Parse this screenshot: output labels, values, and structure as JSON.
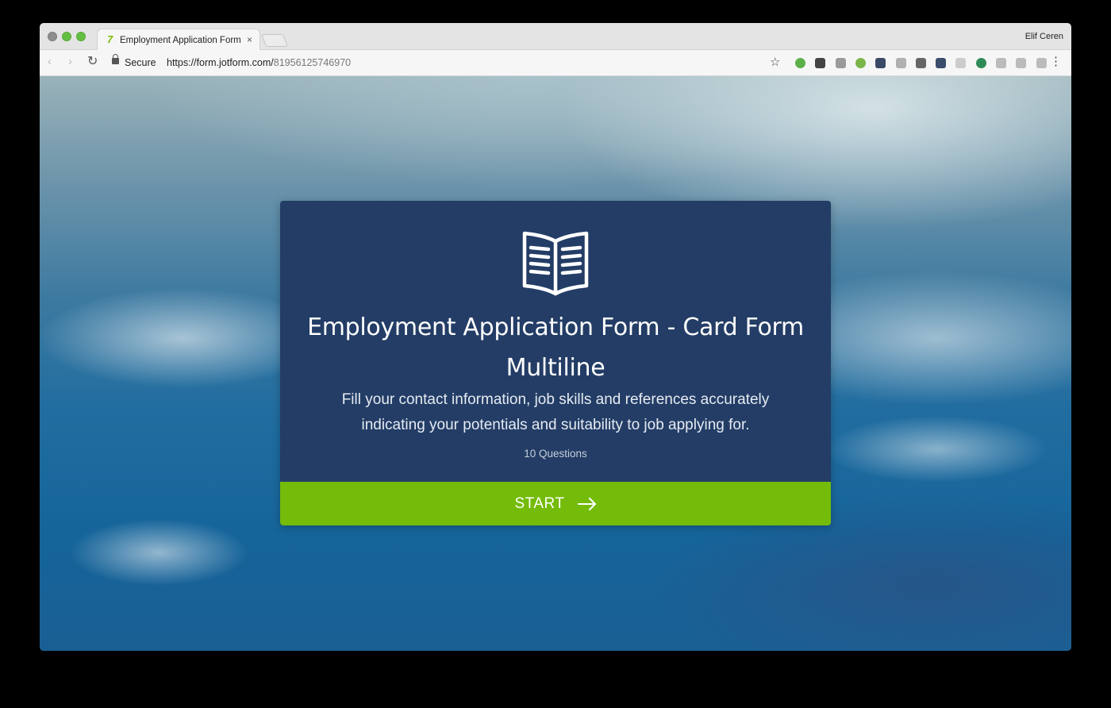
{
  "browser": {
    "tab": {
      "title": "Employment Application Form - Card Form Multiline",
      "close_glyph": "×",
      "favicon_glyph": "7"
    },
    "profile_name": "Elif Ceren",
    "toolbar": {
      "back_glyph": "‹",
      "forward_glyph": "›",
      "reload_glyph": "↻",
      "secure_label": "Secure",
      "url_host": "https://form.jotform.com/",
      "url_path": "81956125746970",
      "star_glyph": "☆",
      "menu_glyph": "⋮"
    },
    "extensions": [
      {
        "name": "ext-green-globe-icon",
        "color": "#5bb04a"
      },
      {
        "name": "ext-panda-icon",
        "color": "#444444"
      },
      {
        "name": "ext-screen-icon",
        "color": "#9a9a9a"
      },
      {
        "name": "ext-green-leaf-icon",
        "color": "#7ab648"
      },
      {
        "name": "ext-mail-icon",
        "color": "#3a4a66"
      },
      {
        "name": "ext-bracket-icon",
        "color": "#b0b0b0"
      },
      {
        "name": "ext-grid-icon",
        "color": "#666666"
      },
      {
        "name": "ext-pocket-icon",
        "color": "#3b4d6b"
      },
      {
        "name": "ext-cursor-icon",
        "color": "#cccccc"
      },
      {
        "name": "ext-green-circle-icon",
        "color": "#2e8b57"
      },
      {
        "name": "ext-columns-icon",
        "color": "#bbbbbb"
      },
      {
        "name": "ext-layout-icon",
        "color": "#bbbbbb"
      },
      {
        "name": "ext-crop-icon",
        "color": "#bbbbbb"
      }
    ]
  },
  "form": {
    "title_line1": "Employment Application Form - Card Form",
    "title_line2": "Multiline",
    "description_line1": "Fill your contact information, job skills and references accurately",
    "description_line2": "indicating your potentials and suitability to job applying for.",
    "question_count": "10 Questions",
    "start_label": "START",
    "colors": {
      "card_background": "#233d66",
      "start_button": "#74bb0a"
    }
  }
}
